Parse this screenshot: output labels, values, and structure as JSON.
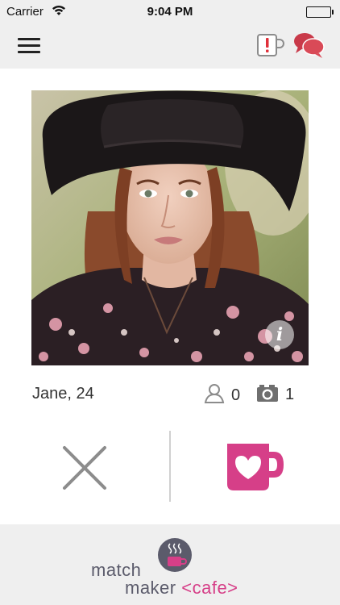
{
  "status_bar": {
    "carrier": "Carrier",
    "time": "9:04 PM",
    "icons": [
      "wifi-icon",
      "battery-icon"
    ]
  },
  "nav": {
    "menu_icon": "hamburger-menu-icon",
    "right_icons": [
      "coffee-alert-icon",
      "chat-bubbles-icon"
    ]
  },
  "profile": {
    "name_age": "Jane, 24",
    "friends_count": "0",
    "photos_count": "1",
    "info_label": "i"
  },
  "actions": {
    "reject_icon": "x-icon",
    "like_icon": "heart-mug-icon"
  },
  "footer": {
    "logo_line1": "match",
    "logo_line2_prefix": "maker ",
    "logo_line2_accent": "<cafe>"
  },
  "colors": {
    "accent_pink": "#d63f88",
    "alert_red": "#e0303a",
    "chat_red": "#c93a4a",
    "bar_gray": "#efefef",
    "icon_gray": "#8c8c8c",
    "logo_gray": "#5b5b6b"
  }
}
